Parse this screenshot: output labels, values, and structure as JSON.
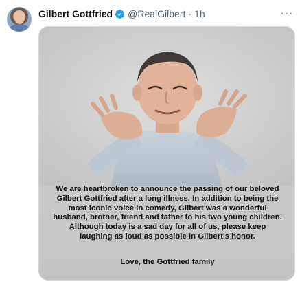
{
  "tweet": {
    "author_name": "Gilbert Gottfried",
    "handle": "@RealGilbert",
    "separator": "·",
    "time": "1h",
    "more_label": "···"
  },
  "media": {
    "statement_lines": [
      "We are heartbroken to announce the passing of our beloved",
      "Gilbert Gottfried after a long illness.  In addition to being the",
      "most iconic voice in comedy, Gilbert was a wonderful",
      "husband, brother, friend and father to his two young children.",
      "Although today is a sad day for all of us, please keep",
      "laughing as loud as possible in Gilbert's honor."
    ],
    "signoff": "Love, the Gottfried family"
  },
  "colors": {
    "verified": "#1d9bf0",
    "secondary_text": "#536471",
    "photo_background": "#d0d0d0"
  },
  "icons": {
    "verified": "verified-badge-icon",
    "more": "more-dots-icon"
  }
}
